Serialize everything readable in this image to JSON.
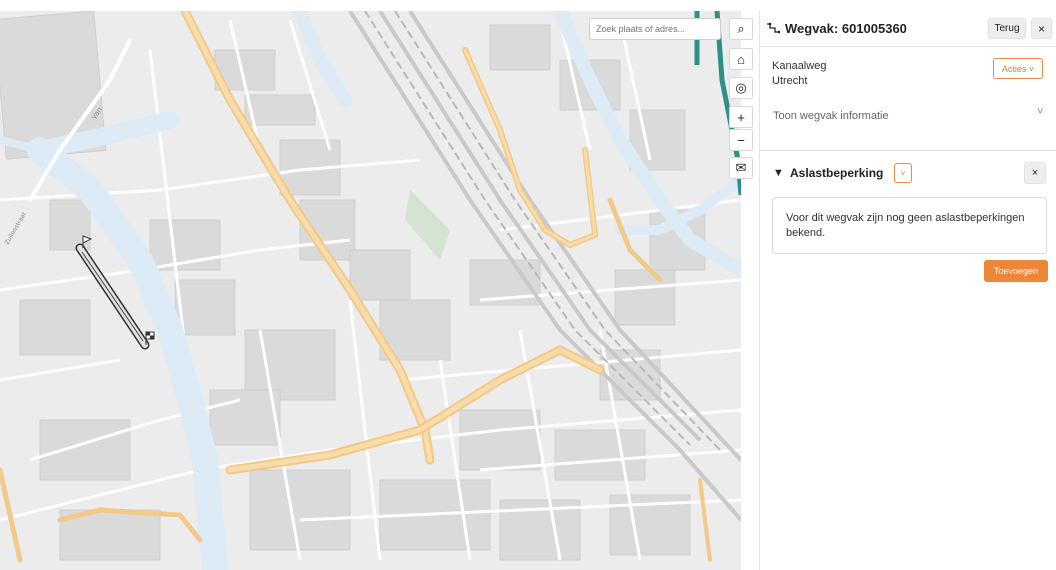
{
  "map": {
    "search_placeholder": "Zoek plaats of adres...",
    "controls": {
      "search": "⌕",
      "home": "⌂",
      "locate": "◎",
      "zoom_in": "+",
      "zoom_out": "−",
      "mail": "✉"
    },
    "street_labels": [
      "Van",
      "Zuilenstraat"
    ]
  },
  "panel": {
    "title": "Wegvak: 601005360",
    "back_button": "Terug",
    "close_glyph": "×",
    "address": {
      "street": "Kanaalweg",
      "city": "Utrecht"
    },
    "actions_button": "Acties ˅",
    "show_info": "Toon wegvak informatie",
    "show_info_chevron": "˅",
    "section": {
      "triangle": "▼",
      "title": "Aslastbeperking",
      "dropdown": "˅",
      "close_glyph": "×",
      "message": "Voor dit wegvak zijn nog geen aslastbeperkingen bekend.",
      "add_button": "Toevoegen"
    }
  },
  "colors": {
    "accent_orange": "#ee8639",
    "road_major": "#f6d49a",
    "water": "#dcebf5",
    "rail_teal": "#2e8f86"
  }
}
